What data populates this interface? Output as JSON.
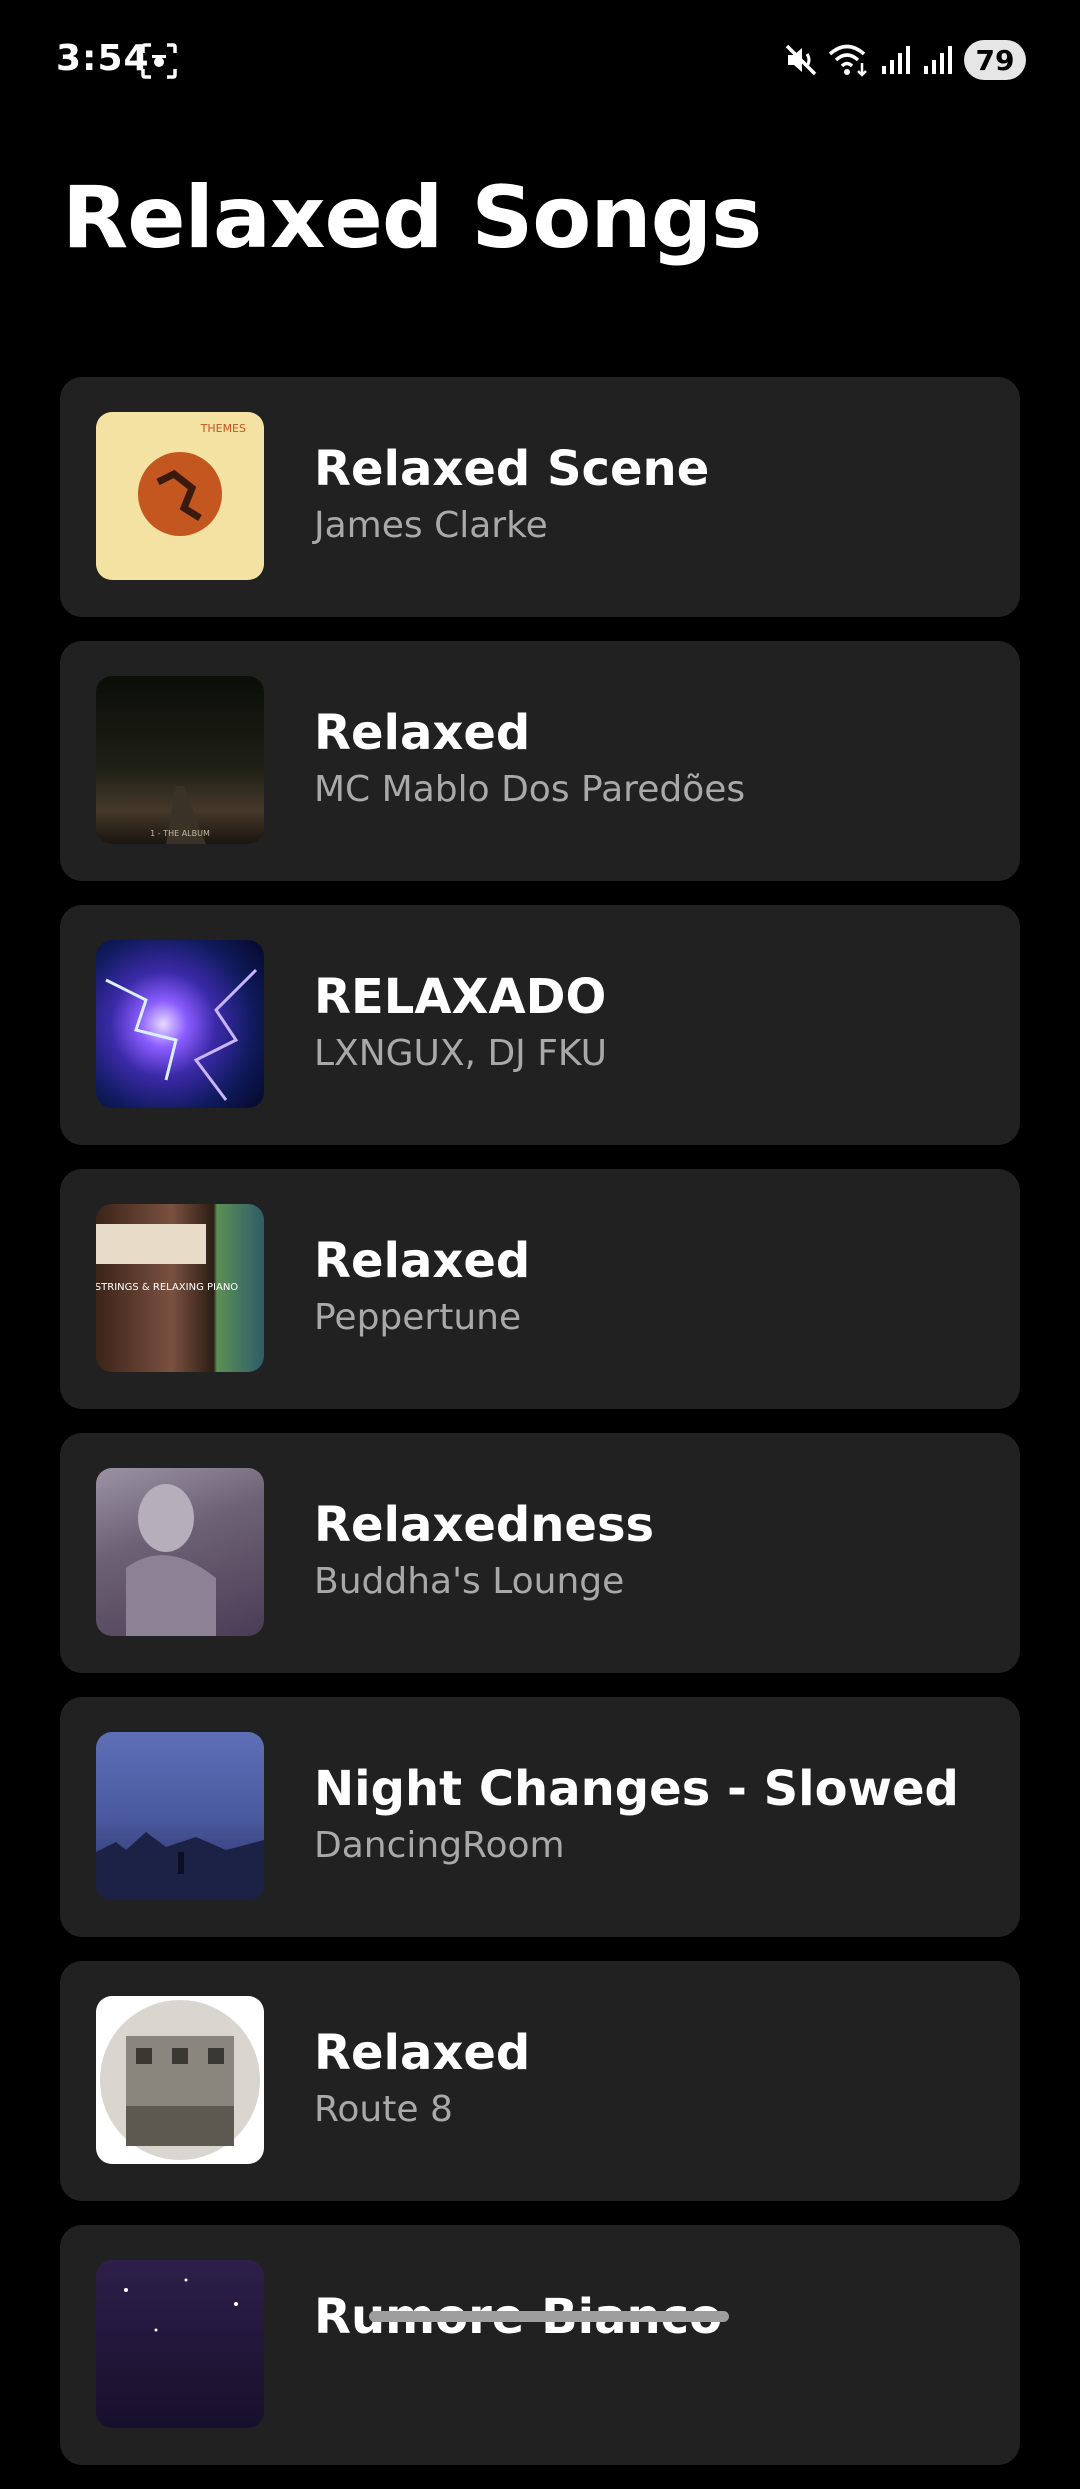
{
  "status_bar": {
    "time": "3:54",
    "battery": "79"
  },
  "page": {
    "title": "Relaxed Songs"
  },
  "songs": [
    {
      "title": "Relaxed Scene",
      "artist": "James Clarke",
      "art": "orange-circle-album-art",
      "art_text": "THEMES"
    },
    {
      "title": "Relaxed",
      "artist": "MC Mablo Dos Paredões",
      "art": "dark-road-album-art",
      "art_text": "1 - THE ALBUM"
    },
    {
      "title": "RELAXADO",
      "artist": "LXNGUX, DJ FKU",
      "art": "lightning-album-art"
    },
    {
      "title": "Relaxed",
      "artist": "Peppertune",
      "art": "piano-album-art",
      "art_text": "COZY STRINGS & RELAXING PIANO"
    },
    {
      "title": "Relaxedness",
      "artist": "Buddha's Lounge",
      "art": "buddha-album-art"
    },
    {
      "title": "Night Changes - Slowed",
      "artist": "DancingRoom",
      "art": "night-sky-album-art"
    },
    {
      "title": "Relaxed",
      "artist": "Route 8",
      "art": "building-album-art"
    },
    {
      "title": "Rumore Bianco",
      "artist": "",
      "art": "starry-album-art"
    }
  ],
  "colors": {
    "background": "#000000",
    "card": "#212121",
    "title_text": "#ffffff",
    "artist_text": "#a9a9a9"
  }
}
